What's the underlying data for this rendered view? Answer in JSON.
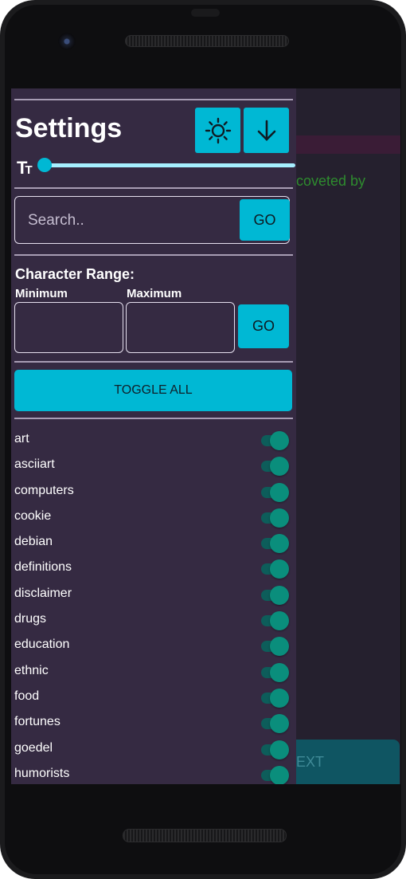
{
  "settings": {
    "title": "Settings",
    "theme_icon": "sun-icon",
    "download_icon": "arrow-down-icon",
    "font_size_icon": "text-size-icon",
    "font_size_level": 0.0
  },
  "search": {
    "placeholder": "Search..",
    "value": "",
    "go_label": "GO"
  },
  "range": {
    "title": "Character Range:",
    "min_label": "Minimum",
    "max_label": "Maximum",
    "min_value": "",
    "max_value": "",
    "go_label": "GO"
  },
  "toggle_all_label": "TOGGLE ALL",
  "categories": [
    {
      "label": "art",
      "enabled": true
    },
    {
      "label": "asciiart",
      "enabled": true
    },
    {
      "label": "computers",
      "enabled": true
    },
    {
      "label": "cookie",
      "enabled": true
    },
    {
      "label": "debian",
      "enabled": true
    },
    {
      "label": "definitions",
      "enabled": true
    },
    {
      "label": "disclaimer",
      "enabled": true
    },
    {
      "label": "drugs",
      "enabled": true
    },
    {
      "label": "education",
      "enabled": true
    },
    {
      "label": "ethnic",
      "enabled": true
    },
    {
      "label": "food",
      "enabled": true
    },
    {
      "label": "fortunes",
      "enabled": true
    },
    {
      "label": "goedel",
      "enabled": true
    },
    {
      "label": "humorists",
      "enabled": true
    }
  ],
  "background": {
    "text": "coveted by",
    "next_label": "EXT"
  },
  "colors": {
    "accent": "#00b8d4",
    "drawer_bg": "#352a42",
    "switch_on": "#0a8e7c",
    "fortune_text": "#2e8b2e"
  }
}
